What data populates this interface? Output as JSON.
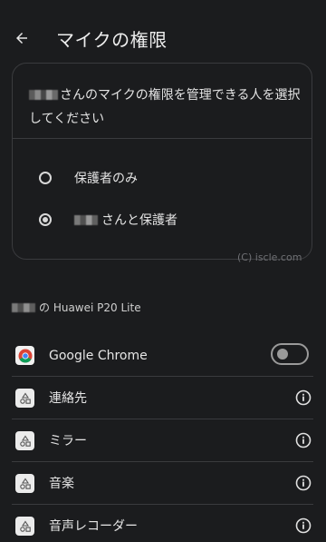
{
  "header": {
    "title": "マイクの権限"
  },
  "card": {
    "heading": "さんのマイクの権限を管理できる人を選択してください",
    "options": [
      {
        "label": "保護者のみ",
        "selected": false
      },
      {
        "label": "さんと保護者",
        "selected": true
      }
    ]
  },
  "watermark": "(C) iscle.com",
  "device": {
    "label": "の Huawei P20 Lite"
  },
  "apps": [
    {
      "name": "Google Chrome",
      "control": "toggle",
      "toggle_on": false,
      "icon": "chrome-icon"
    },
    {
      "name": "連絡先",
      "control": "info",
      "icon": "generic-app-icon"
    },
    {
      "name": "ミラー",
      "control": "info",
      "icon": "generic-app-icon"
    },
    {
      "name": "音楽",
      "control": "info",
      "icon": "generic-app-icon"
    },
    {
      "name": "音声レコーダー",
      "control": "info",
      "icon": "generic-app-icon"
    }
  ]
}
